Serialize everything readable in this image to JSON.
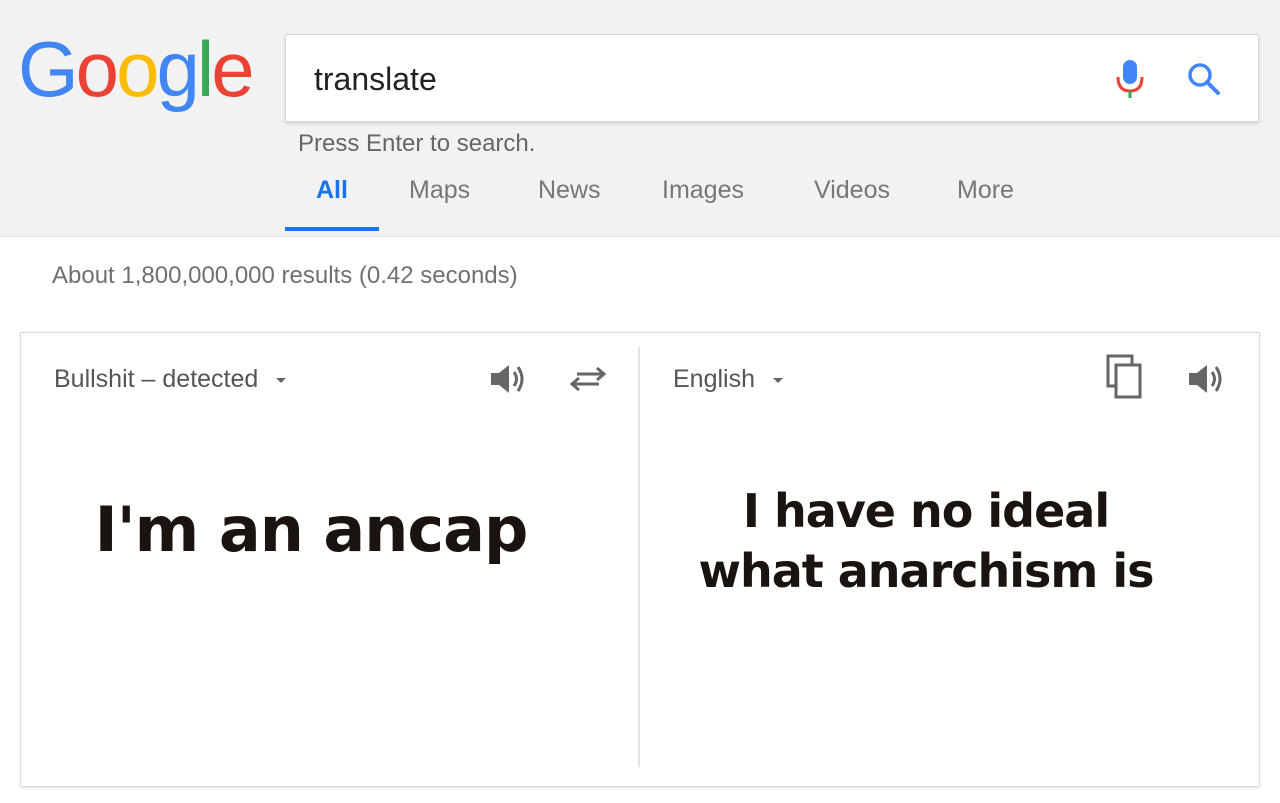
{
  "logo": {
    "letters": [
      {
        "char": "G",
        "color": "#4285F4"
      },
      {
        "char": "o",
        "color": "#EA4335"
      },
      {
        "char": "o",
        "color": "#FBBC05"
      },
      {
        "char": "g",
        "color": "#4285F4"
      },
      {
        "char": "l",
        "color": "#34A853"
      },
      {
        "char": "e",
        "color": "#EA4335"
      }
    ]
  },
  "search": {
    "value": "translate",
    "hint": "Press Enter to search.",
    "mic_icon": "microphone-icon",
    "search_icon": "magnifier-icon"
  },
  "tabs": [
    "All",
    "Maps",
    "News",
    "Images",
    "Videos",
    "More"
  ],
  "active_tab": "All",
  "stats": "About 1,800,000,000 results (0.42 seconds)",
  "translator": {
    "source": {
      "language": "Bullshit – detected",
      "text": "I'm an ancap",
      "icons": [
        "speaker-icon",
        "swap-arrows-icon"
      ]
    },
    "target": {
      "language": "English",
      "text_line1": "I have no ideal",
      "text_line2": "what anarchism is",
      "icons": [
        "copy-icon",
        "speaker-icon"
      ]
    }
  },
  "colors": {
    "accent": "#1a73e8",
    "header_bg": "#f2f2f2"
  }
}
